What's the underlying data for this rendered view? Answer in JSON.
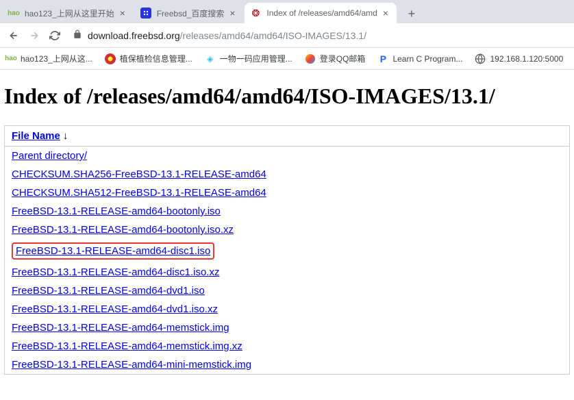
{
  "tabs": [
    {
      "title": "hao123_上网从这里开始"
    },
    {
      "title": "Freebsd_百度搜索"
    },
    {
      "title": "Index of /releases/amd64/amd"
    }
  ],
  "url": {
    "host": "download.freebsd.org",
    "path": "/releases/amd64/amd64/ISO-IMAGES/13.1/"
  },
  "bookmarks": [
    {
      "text": "hao123_上网从这..."
    },
    {
      "text": "植保植检信息管理..."
    },
    {
      "text": "一物一码应用管理..."
    },
    {
      "text": "登录QQ邮箱"
    },
    {
      "text": "Learn C Program..."
    },
    {
      "text": "192.168.1.120:5000"
    }
  ],
  "page": {
    "heading": "Index of /releases/amd64/amd64/ISO-IMAGES/13.1/",
    "columnHeader": "File Name",
    "sortIndicator": "↓",
    "files": [
      "Parent directory/",
      "CHECKSUM.SHA256-FreeBSD-13.1-RELEASE-amd64",
      "CHECKSUM.SHA512-FreeBSD-13.1-RELEASE-amd64",
      "FreeBSD-13.1-RELEASE-amd64-bootonly.iso",
      "FreeBSD-13.1-RELEASE-amd64-bootonly.iso.xz",
      "FreeBSD-13.1-RELEASE-amd64-disc1.iso",
      "FreeBSD-13.1-RELEASE-amd64-disc1.iso.xz",
      "FreeBSD-13.1-RELEASE-amd64-dvd1.iso",
      "FreeBSD-13.1-RELEASE-amd64-dvd1.iso.xz",
      "FreeBSD-13.1-RELEASE-amd64-memstick.img",
      "FreeBSD-13.1-RELEASE-amd64-memstick.img.xz",
      "FreeBSD-13.1-RELEASE-amd64-mini-memstick.img"
    ],
    "highlightedIndex": 5
  }
}
